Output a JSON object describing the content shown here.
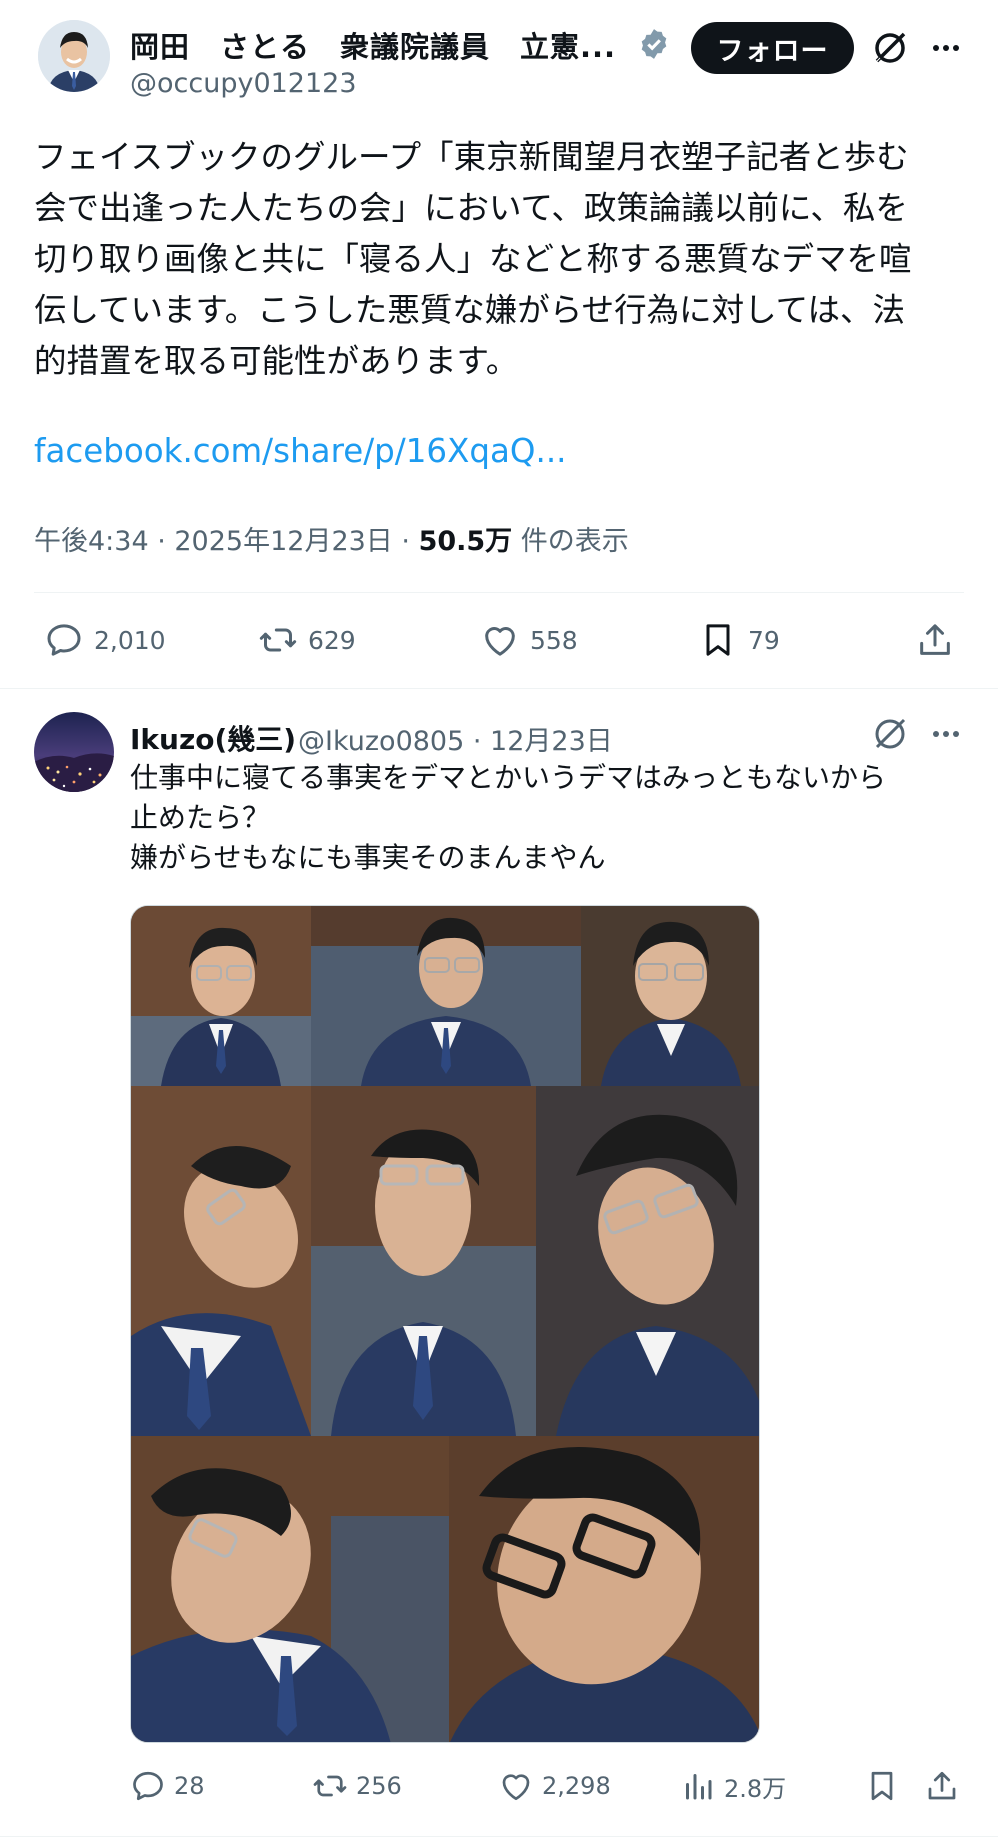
{
  "main_tweet": {
    "author_name": "岡田　さとる　衆議院議員　立憲...",
    "handle": "@occupy012123",
    "follow_label": "フォロー",
    "body_lines": [
      "フェイスブックのグループ「東京新聞望月衣塑子記者と歩む",
      "会で出逢った人たちの会」において、政策論議以前に、私を",
      "切り取り画像と共に「寝る人」などと称する悪質なデマを喧",
      "伝しています。こうした悪質な嫌がらせ行為に対しては、法",
      "的措置を取る可能性があります。"
    ],
    "link_text": "facebook.com/share/p/16XqaQ...",
    "time": "午後4:34 · 2025年12月23日 · ",
    "views_count": "50.5万",
    "views_label": " 件の表示",
    "stats": {
      "replies": "2,010",
      "retweets": "629",
      "likes": "558",
      "bookmarks": "79"
    }
  },
  "reply_tweet": {
    "author_name": "Ikuzo(幾三)",
    "handle_date": "@Ikuzo0805 · 12月23日",
    "body_lines": [
      "仕事中に寝てる事実をデマとかいうデマはみっともないから",
      "止めたら？",
      "嫌がらせもなにも事実そのまんまやん"
    ],
    "stats": {
      "replies": "28",
      "retweets": "256",
      "likes": "2,298",
      "views": "2.8万"
    }
  },
  "icons": {
    "verified": "verified-badge-icon",
    "grok": "grok-icon",
    "more": "more-icon",
    "reply": "reply-icon",
    "retweet": "retweet-icon",
    "like": "heart-icon",
    "bookmark": "bookmark-icon",
    "share": "share-icon",
    "views": "views-icon"
  },
  "colors": {
    "link": "#1d9bf0",
    "secondary_text": "#536471",
    "primary_text": "#0f1419",
    "follow_button_bg": "#0f1419"
  }
}
